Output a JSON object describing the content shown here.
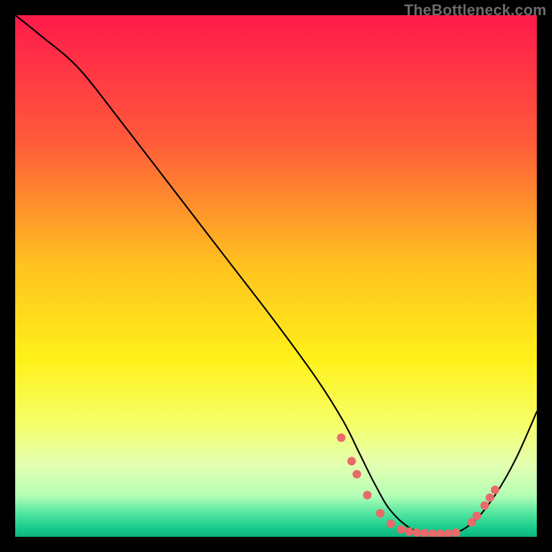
{
  "watermark": "TheBottleneck.com",
  "chart_data": {
    "type": "line",
    "title": "",
    "xlabel": "",
    "ylabel": "",
    "xlim": [
      0,
      100
    ],
    "ylim": [
      0,
      100
    ],
    "grid": false,
    "gradient_stops": [
      {
        "t": 0.0,
        "color": "#ff1a4b"
      },
      {
        "t": 0.24,
        "color": "#ff5a3a"
      },
      {
        "t": 0.48,
        "color": "#ffc21f"
      },
      {
        "t": 0.66,
        "color": "#fff11a"
      },
      {
        "t": 0.78,
        "color": "#f6ff66"
      },
      {
        "t": 0.86,
        "color": "#e3ffb0"
      },
      {
        "t": 0.92,
        "color": "#b6ffb6"
      },
      {
        "t": 0.955,
        "color": "#52e6a0"
      },
      {
        "t": 0.985,
        "color": "#14c98a"
      },
      {
        "t": 1.0,
        "color": "#0fb37d"
      }
    ],
    "series": [
      {
        "name": "bottleneck-curve",
        "x": [
          0,
          5,
          12,
          20,
          30,
          40,
          50,
          58,
          63,
          66,
          69,
          72,
          76,
          80,
          84,
          88,
          92,
          96,
          100
        ],
        "y": [
          100,
          96,
          90,
          80,
          67,
          54,
          41,
          30,
          22,
          16,
          10,
          5,
          1.5,
          0.6,
          0.6,
          3,
          8,
          15,
          24
        ]
      }
    ],
    "markers": {
      "name": "highlighted-points",
      "color": "#e86a6a",
      "points": [
        {
          "x": 62.5,
          "y": 19
        },
        {
          "x": 64.5,
          "y": 14.5
        },
        {
          "x": 65.5,
          "y": 12
        },
        {
          "x": 67.5,
          "y": 8
        },
        {
          "x": 70.0,
          "y": 4.5
        },
        {
          "x": 72.0,
          "y": 2.5
        },
        {
          "x": 74.0,
          "y": 1.4
        },
        {
          "x": 75.5,
          "y": 1.0
        },
        {
          "x": 77.0,
          "y": 0.8
        },
        {
          "x": 78.5,
          "y": 0.7
        },
        {
          "x": 80.0,
          "y": 0.6
        },
        {
          "x": 81.5,
          "y": 0.6
        },
        {
          "x": 83.0,
          "y": 0.6
        },
        {
          "x": 84.5,
          "y": 0.8
        },
        {
          "x": 87.5,
          "y": 2.8
        },
        {
          "x": 88.5,
          "y": 4.0
        },
        {
          "x": 90.0,
          "y": 6.0
        },
        {
          "x": 91.0,
          "y": 7.5
        },
        {
          "x": 92.0,
          "y": 9.0
        }
      ]
    }
  }
}
